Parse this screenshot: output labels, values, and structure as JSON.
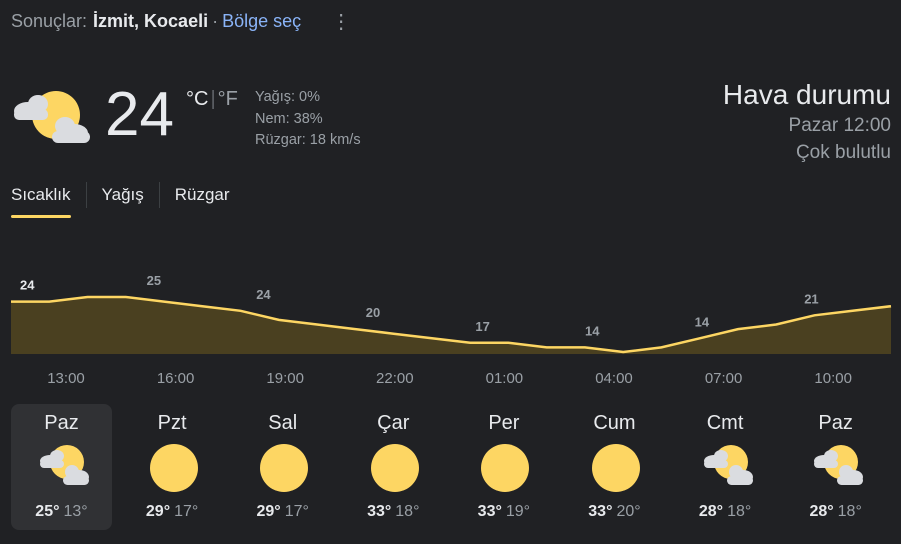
{
  "header": {
    "prefix": "Sonuçlar:",
    "location": "İzmit, Kocaeli",
    "separator": "·",
    "region_link": "Bölge seç",
    "more_icon": "more-vert-icon"
  },
  "current": {
    "icon": "partly-cloudy-icon",
    "temperature": "24",
    "unit_c": "°C",
    "unit_sep": "|",
    "unit_f": "°F",
    "precip": "Yağış: 0%",
    "humidity": "Nem: 38%",
    "wind": "Rüzgar: 18 km/s"
  },
  "summary": {
    "title": "Hava durumu",
    "time": "Pazar 12:00",
    "condition": "Çok bulutlu"
  },
  "tabs": [
    {
      "label": "Sıcaklık",
      "active": true
    },
    {
      "label": "Yağış",
      "active": false
    },
    {
      "label": "Rüzgar",
      "active": false
    }
  ],
  "chart_data": {
    "type": "area",
    "x": [
      "13:00",
      "14:00",
      "15:00",
      "16:00",
      "17:00",
      "18:00",
      "19:00",
      "20:00",
      "21:00",
      "22:00",
      "23:00",
      "00:00",
      "01:00",
      "02:00",
      "03:00",
      "04:00",
      "05:00",
      "06:00",
      "07:00",
      "08:00",
      "09:00",
      "10:00",
      "11:00",
      "12:00"
    ],
    "values": [
      24,
      24,
      25,
      25,
      24,
      23,
      22,
      20,
      19,
      18,
      17,
      16,
      15,
      15,
      14,
      14,
      13,
      14,
      16,
      18,
      19,
      21,
      22,
      23
    ],
    "labeled_points": [
      {
        "x": "13:00",
        "label": "24"
      },
      {
        "x": "16:00",
        "label": "25"
      },
      {
        "x": "19:00",
        "label": "24"
      },
      {
        "x": "22:00",
        "label": "20"
      },
      {
        "x": "01:00",
        "label": "17"
      },
      {
        "x": "04:00",
        "label": "14"
      },
      {
        "x": "07:00",
        "label": "14"
      },
      {
        "x": "10:00",
        "label": "21"
      }
    ],
    "color": "#fdd663",
    "fill": "#4a4020"
  },
  "days": [
    {
      "name": "Paz",
      "icon": "partly-cloudy-icon",
      "hi": "25°",
      "lo": "13°",
      "selected": true
    },
    {
      "name": "Pzt",
      "icon": "sun-icon",
      "hi": "29°",
      "lo": "17°",
      "selected": false
    },
    {
      "name": "Sal",
      "icon": "sun-icon",
      "hi": "29°",
      "lo": "17°",
      "selected": false
    },
    {
      "name": "Çar",
      "icon": "sun-icon",
      "hi": "33°",
      "lo": "18°",
      "selected": false
    },
    {
      "name": "Per",
      "icon": "sun-icon",
      "hi": "33°",
      "lo": "19°",
      "selected": false
    },
    {
      "name": "Cum",
      "icon": "sun-icon",
      "hi": "33°",
      "lo": "20°",
      "selected": false
    },
    {
      "name": "Cmt",
      "icon": "partly-cloudy-icon",
      "hi": "28°",
      "lo": "18°",
      "selected": false
    },
    {
      "name": "Paz",
      "icon": "partly-cloudy-icon",
      "hi": "28°",
      "lo": "18°",
      "selected": false
    }
  ]
}
